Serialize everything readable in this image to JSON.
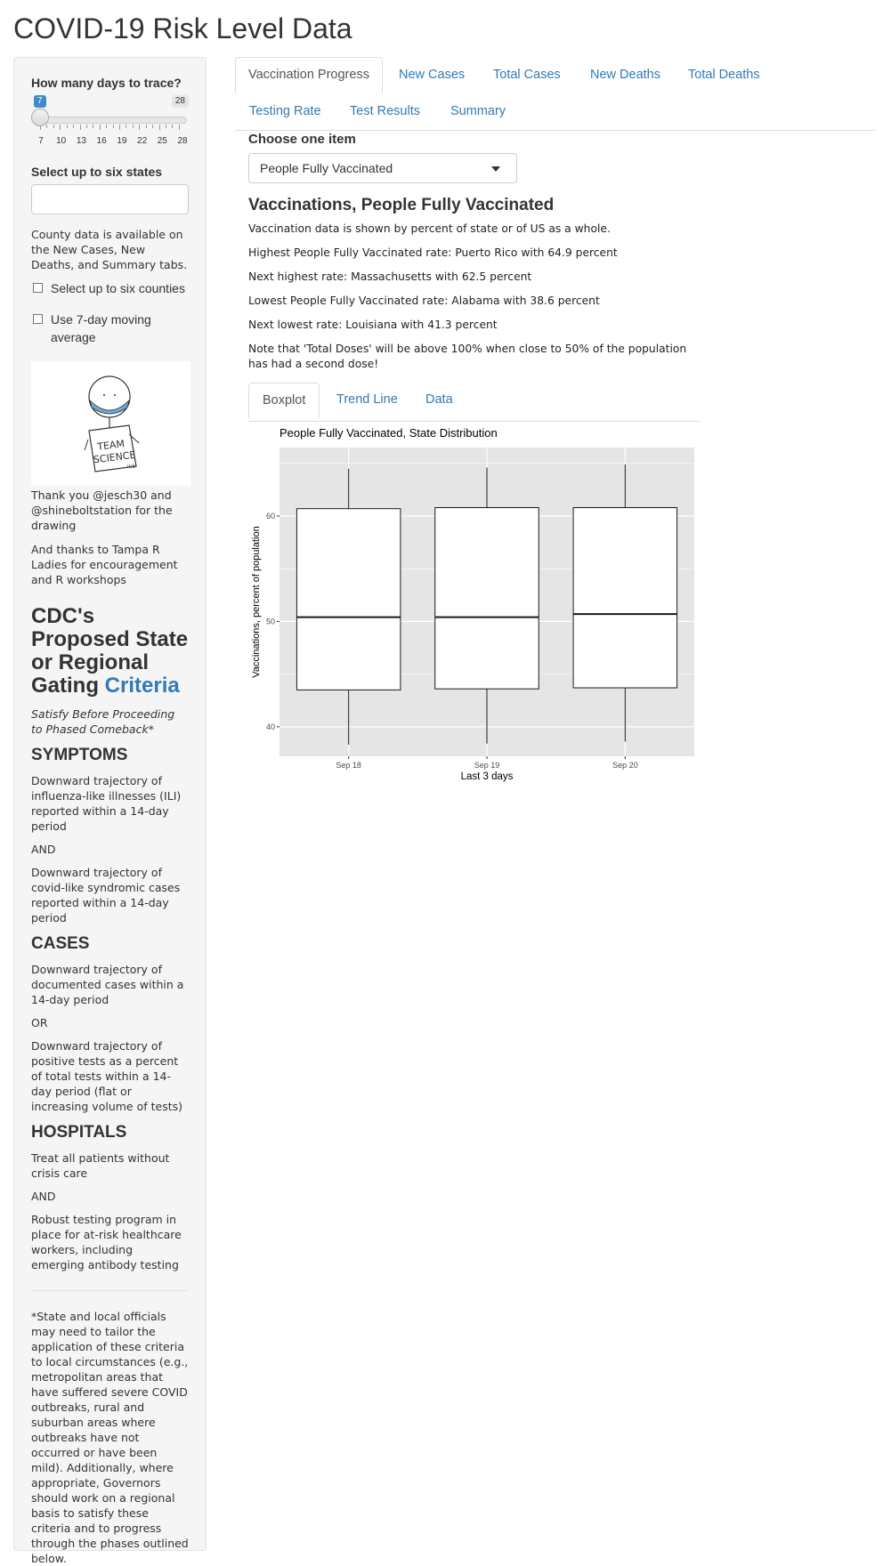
{
  "app": {
    "title": "COVID-19 Risk Level Data"
  },
  "sidebar": {
    "days_label": "How many days to trace?",
    "slider": {
      "min_label": "7",
      "max_label": "28",
      "value_label": "7",
      "tick_labels": [
        "7",
        "10",
        "13",
        "16",
        "19",
        "22",
        "25",
        "28"
      ]
    },
    "states_label": "Select up to six states",
    "states_input_value": "",
    "county_note": "County data is available on the New Cases, New Deaths, and Summary tabs.",
    "counties_checkbox": "Select up to six counties",
    "moving_avg_checkbox": "Use 7-day moving average",
    "drawing_text": "TEAM SCIENCE",
    "thanks1": "Thank you @jesch30 and @shineboltstation for the drawing",
    "thanks2": "And thanks to Tampa R Ladies for encouragement and R workshops",
    "cdc_heading_prefix": "CDC's Proposed State or Regional Gating",
    "cdc_heading_link": "Criteria",
    "satisfy": "Satisfy Before Proceeding to Phased Comeback*",
    "symptoms_head": "SYMPTOMS",
    "symptoms_1": "Downward trajectory of influenza-like illnesses (ILI) reported within a 14-day period",
    "and_1": "AND",
    "symptoms_2": "Downward trajectory of covid-like syndromic cases reported within a 14-day period",
    "cases_head": "CASES",
    "cases_1": "Downward trajectory of documented cases within a 14-day period",
    "or_1": "OR",
    "cases_2": "Downward trajectory of positive tests as a percent of total tests within a 14-day period (flat or increasing volume of tests)",
    "hospitals_head": "HOSPITALS",
    "hospitals_1": "Treat all patients without crisis care",
    "and_2": "AND",
    "hospitals_2": "Robust testing program in place for at-risk healthcare workers, including emerging antibody testing",
    "footnote": "*State and local officials may need to tailor the application of these criteria to local circumstances (e.g., metropolitan areas that have suffered severe COVID outbreaks, rural and suburban areas where outbreaks have not occurred or have been mild). Additionally, where appropriate, Governors should work on a regional basis to satisfy these criteria and to progress through the phases outlined below."
  },
  "tabs": {
    "vaccination_progress": "Vaccination Progress",
    "new_cases": "New Cases",
    "total_cases": "Total Cases",
    "new_deaths": "New Deaths",
    "total_deaths": "Total Deaths",
    "testing_rate": "Testing Rate",
    "test_results": "Test Results",
    "summary": "Summary"
  },
  "content": {
    "choose_label": "Choose one item",
    "select_value": "People Fully Vaccinated",
    "title": "Vaccinations, People Fully Vaccinated",
    "p1": "Vaccination data is shown by percent of state or of US as a whole.",
    "p2": "Highest People Fully Vaccinated rate: Puerto Rico with 64.9 percent",
    "p3": "Next highest rate: Massachusetts with 62.5 percent",
    "p4": "Lowest People Fully Vaccinated rate: Alabama with 38.6 percent",
    "p5": "Next lowest rate: Louisiana with 41.3 percent",
    "p6": "Note that 'Total Doses' will be above 100% when close to 50% of the population has had a second dose!"
  },
  "subtabs": {
    "boxplot": "Boxplot",
    "trend_line": "Trend Line",
    "data": "Data"
  },
  "chart_data": {
    "type": "boxplot",
    "title": "People Fully Vaccinated, State Distribution",
    "xlabel": "Last 3 days",
    "ylabel": "Vaccinations, percent of population",
    "categories": [
      "Sep 18",
      "Sep 19",
      "Sep 20"
    ],
    "ylim": [
      37.2,
      66.5
    ],
    "yticks": [
      40,
      50,
      60
    ],
    "boxes": [
      {
        "whisker_low": 38.3,
        "q1": 43.5,
        "median": 50.4,
        "q3": 60.7,
        "whisker_high": 64.5
      },
      {
        "whisker_low": 38.4,
        "q1": 43.6,
        "median": 50.4,
        "q3": 60.8,
        "whisker_high": 64.6
      },
      {
        "whisker_low": 38.6,
        "q1": 43.7,
        "median": 50.7,
        "q3": 60.8,
        "whisker_high": 64.9
      }
    ],
    "colors": {
      "panel": "#e5e5e5",
      "grid": "#ffffff",
      "box_fill": "#ffffff",
      "box_line": "#1a1a1a"
    },
    "legend": "none",
    "grid": true
  }
}
